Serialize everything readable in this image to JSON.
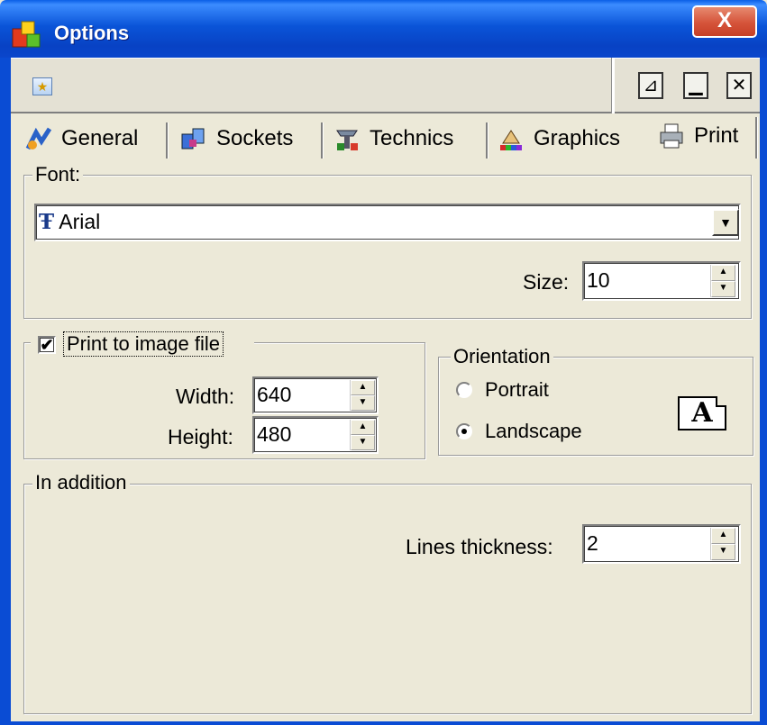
{
  "window": {
    "title": "Options",
    "close_label": "X"
  },
  "toolbar": {
    "btn_a": "⊿",
    "btn_b": "▁",
    "btn_c": "✕"
  },
  "tabs": [
    {
      "label": "General"
    },
    {
      "label": "Sockets"
    },
    {
      "label": "Technics"
    },
    {
      "label": "Graphics"
    },
    {
      "label": "Print"
    }
  ],
  "font_group": {
    "legend": "Font:",
    "font_name": "Arial",
    "font_icon": "Ŧ",
    "size_label": "Size:",
    "size_value": "10"
  },
  "image_file": {
    "checkbox_label": "Print to image file",
    "checked": true,
    "check_glyph": "✔",
    "width_label": "Width:",
    "width_value": "640",
    "height_label": "Height:",
    "height_value": "480"
  },
  "orientation": {
    "legend": "Orientation",
    "portrait_label": "Portrait",
    "landscape_label": "Landscape",
    "selected": "Landscape",
    "page_letter": "A"
  },
  "addition": {
    "legend": "In addition",
    "lines_label": "Lines thickness:",
    "lines_value": "2"
  },
  "colors": {
    "titlebar": "#0A54D8",
    "close": "#D5533A",
    "face": "#ECE9D8"
  }
}
